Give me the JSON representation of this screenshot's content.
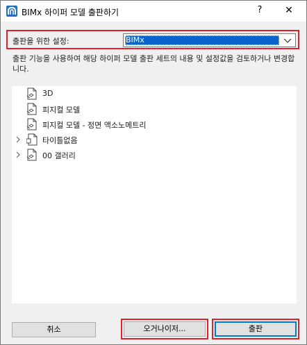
{
  "window": {
    "title": "BIMx 하이퍼 모델 출판하기",
    "help_label": "?",
    "close_label": "✕"
  },
  "settings": {
    "label": "출판을 위한 설정:",
    "selected_value": "BIMx"
  },
  "description": "출판 기능을 사용하여 해당 하이퍼 모델 출판 세트의 내용 및 설정값을 검토하거나 변경합니다.",
  "tree": {
    "items": [
      {
        "label": "3D",
        "icon": "document-3d-icon",
        "expandable": false
      },
      {
        "label": "피지컬 모델",
        "icon": "document-model-icon",
        "expandable": false
      },
      {
        "label": "피지컬 모델 - 정면 액소노메트리",
        "icon": "document-model-icon",
        "expandable": false
      },
      {
        "label": "타이틀없음",
        "icon": "folder-document-icon",
        "expandable": true
      },
      {
        "label": "00 갤러리",
        "icon": "document-gallery-icon",
        "expandable": true
      }
    ]
  },
  "buttons": {
    "cancel": "취소",
    "organizer": "오거나이저...",
    "publish": "출판"
  },
  "colors": {
    "highlight_border": "#e0202a",
    "selection": "#0a64d0",
    "primary_border": "#0078d7"
  }
}
